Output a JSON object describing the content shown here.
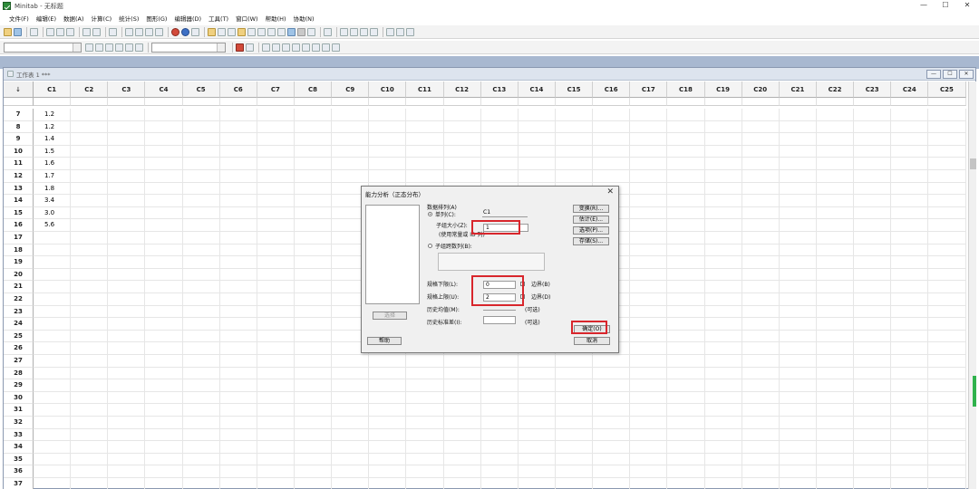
{
  "window": {
    "title": "Minitab - 无标题",
    "min_glyph": "—",
    "max_glyph": "☐",
    "close_glyph": "✕"
  },
  "menu": [
    "文件(F)",
    "编辑(E)",
    "数据(A)",
    "计算(C)",
    "统计(S)",
    "图形(G)",
    "编辑器(D)",
    "工具(T)",
    "窗口(W)",
    "帮助(H)",
    "协助(N)"
  ],
  "worksheet": {
    "title": "工作表 1 ***",
    "corner": "↓",
    "columns": [
      "C1",
      "C2",
      "C3",
      "C4",
      "C5",
      "C6",
      "C7",
      "C8",
      "C9",
      "C10",
      "C11",
      "C12",
      "C13",
      "C14",
      "C15",
      "C16",
      "C17",
      "C18",
      "C19",
      "C20",
      "C21",
      "C22",
      "C23",
      "C24",
      "C25"
    ],
    "rows": [
      "7",
      "8",
      "9",
      "10",
      "11",
      "12",
      "13",
      "14",
      "15",
      "16",
      "17",
      "18",
      "19",
      "20",
      "21",
      "22",
      "23",
      "24",
      "25",
      "26",
      "27",
      "28",
      "29",
      "30",
      "31",
      "32",
      "33",
      "34",
      "35",
      "36",
      "37"
    ],
    "c1_values": [
      "1.2",
      "1.2",
      "1.4",
      "1.5",
      "1.6",
      "1.7",
      "1.8",
      "3.4",
      "3.0",
      "5.6"
    ]
  },
  "dialog": {
    "title": "能力分析（正态分布）",
    "close_glyph": "✕",
    "data_arrangement_label": "数据排列(A)",
    "single_column_label": "单列(C):",
    "single_column_value": "C1",
    "subgroup_size_label": "子组大小(Z):",
    "subgroup_size_value": "1",
    "subgroup_hint": "(使用常量或 ID 列)",
    "subgroups_across_label": "子组跨数列(B):",
    "lower_spec_label": "规格下限(L):",
    "lower_spec_value": "0",
    "upper_spec_label": "规格上限(U):",
    "upper_spec_value": "2",
    "boundary_lower_label": "边界(B)",
    "boundary_upper_label": "边界(D)",
    "hist_mean_label": "历史均值(M):",
    "hist_std_label": "历史标准差(I):",
    "optional_label": "(可选)",
    "select_button": "选择",
    "help_button": "帮助",
    "transform_button": "变换(R)...",
    "estimate_button": "估计(E)...",
    "options_button": "选项(P)...",
    "storage_button": "存储(S)...",
    "ok_button": "确定(O)",
    "cancel_button": "取消"
  },
  "colors": {
    "highlight": "#d8262c",
    "scroll_indicator": "#2fb24c"
  }
}
